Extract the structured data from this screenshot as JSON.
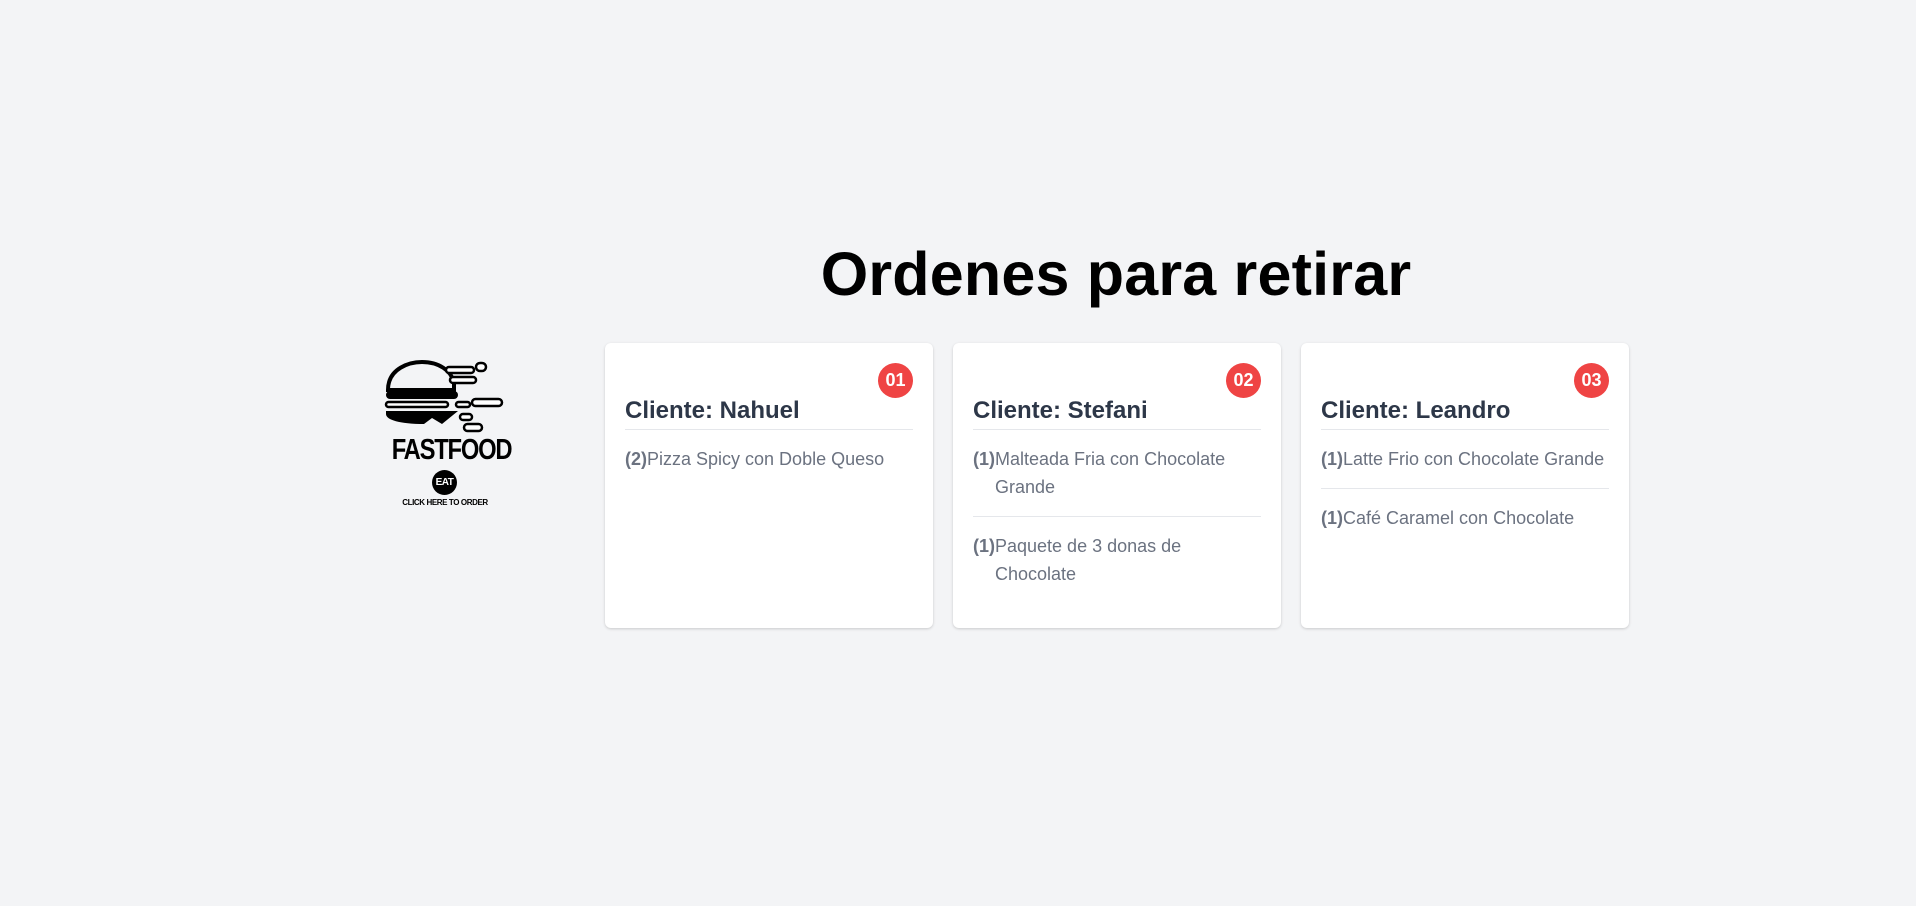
{
  "page": {
    "title": "Ordenes para retirar"
  },
  "logo": {
    "icon": "burger-icon",
    "brand_name": "FASTFOOD",
    "badge": "EAT",
    "cta": "CLICK HERE TO ORDER"
  },
  "colors": {
    "background": "#f3f4f6",
    "badge": "#ef4444",
    "card": "#ffffff",
    "heading": "#2d3748",
    "item_text": "#6b7280"
  },
  "orders": [
    {
      "number": "01",
      "client_label": "Cliente: Nahuel",
      "items": [
        {
          "qty": "(2)",
          "product": "Pizza Spicy con Doble Queso"
        }
      ]
    },
    {
      "number": "02",
      "client_label": "Cliente: Stefani",
      "items": [
        {
          "qty": "(1)",
          "product": "Malteada Fria con Chocolate Grande"
        },
        {
          "qty": "(1)",
          "product": "Paquete de 3 donas de Chocolate"
        }
      ]
    },
    {
      "number": "03",
      "client_label": "Cliente: Leandro",
      "items": [
        {
          "qty": "(1)",
          "product": "Latte Frio con Chocolate Grande"
        },
        {
          "qty": "(1)",
          "product": "Café Caramel con Chocolate"
        }
      ]
    }
  ]
}
